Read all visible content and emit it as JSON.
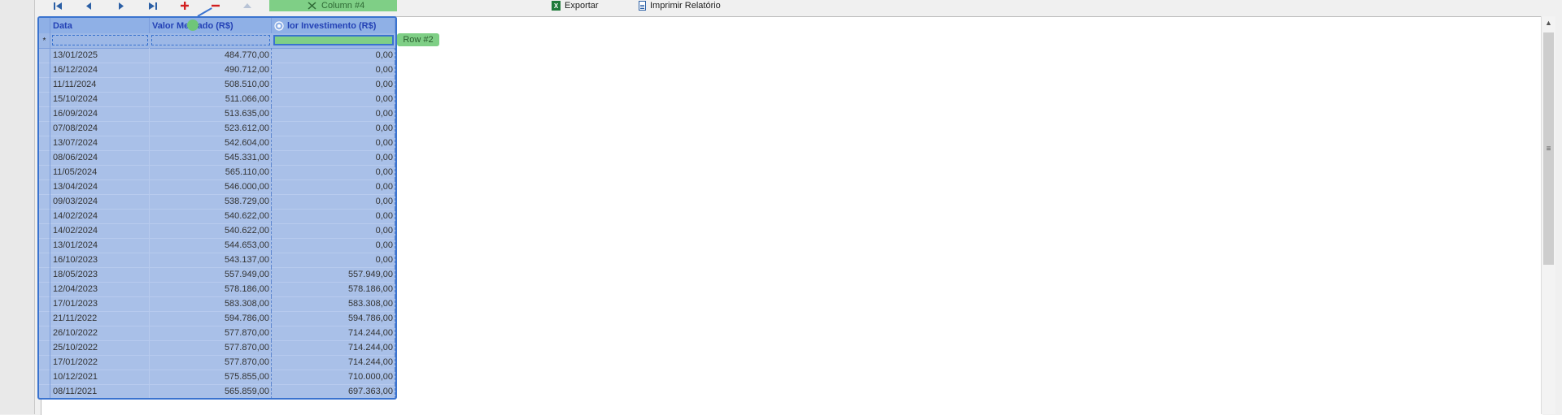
{
  "toolbar": {
    "buttons": [
      "first",
      "prev",
      "next",
      "last",
      "add",
      "remove",
      "up"
    ],
    "export_label": "Exportar",
    "print_label": "Imprimir Relatório",
    "confirm_icon": "check-icon",
    "cancel_icon": "x-icon"
  },
  "overlay": {
    "column_tag": "Column #4",
    "row_tag": "Row #2"
  },
  "grid": {
    "columns": [
      "Data",
      "Valor Mercado (R$)",
      "lor Investimento (R$)"
    ],
    "new_row_marker": "*",
    "rows": [
      [
        "13/01/2025",
        "484.770,00",
        "0,00"
      ],
      [
        "16/12/2024",
        "490.712,00",
        "0,00"
      ],
      [
        "11/11/2024",
        "508.510,00",
        "0,00"
      ],
      [
        "15/10/2024",
        "511.066,00",
        "0,00"
      ],
      [
        "16/09/2024",
        "513.635,00",
        "0,00"
      ],
      [
        "07/08/2024",
        "523.612,00",
        "0,00"
      ],
      [
        "13/07/2024",
        "542.604,00",
        "0,00"
      ],
      [
        "08/06/2024",
        "545.331,00",
        "0,00"
      ],
      [
        "11/05/2024",
        "565.110,00",
        "0,00"
      ],
      [
        "13/04/2024",
        "546.000,00",
        "0,00"
      ],
      [
        "09/03/2024",
        "538.729,00",
        "0,00"
      ],
      [
        "14/02/2024",
        "540.622,00",
        "0,00"
      ],
      [
        "14/02/2024",
        "540.622,00",
        "0,00"
      ],
      [
        "13/01/2024",
        "544.653,00",
        "0,00"
      ],
      [
        "16/10/2023",
        "543.137,00",
        "0,00"
      ],
      [
        "18/05/2023",
        "557.949,00",
        "557.949,00"
      ],
      [
        "12/04/2023",
        "578.186,00",
        "578.186,00"
      ],
      [
        "17/01/2023",
        "583.308,00",
        "583.308,00"
      ],
      [
        "21/11/2022",
        "594.786,00",
        "594.786,00"
      ],
      [
        "26/10/2022",
        "577.870,00",
        "714.244,00"
      ],
      [
        "25/10/2022",
        "577.870,00",
        "714.244,00"
      ],
      [
        "17/01/2022",
        "577.870,00",
        "714.244,00"
      ],
      [
        "10/12/2021",
        "575.855,00",
        "710.000,00"
      ],
      [
        "08/11/2021",
        "565.859,00",
        "697.363,00"
      ]
    ]
  },
  "colors": {
    "selection_fill": "#a9c0e8",
    "selection_border": "#3a73cf",
    "header_text": "#2341b5",
    "tag_green": "#7fcf86",
    "add_red": "#d21f1f"
  }
}
